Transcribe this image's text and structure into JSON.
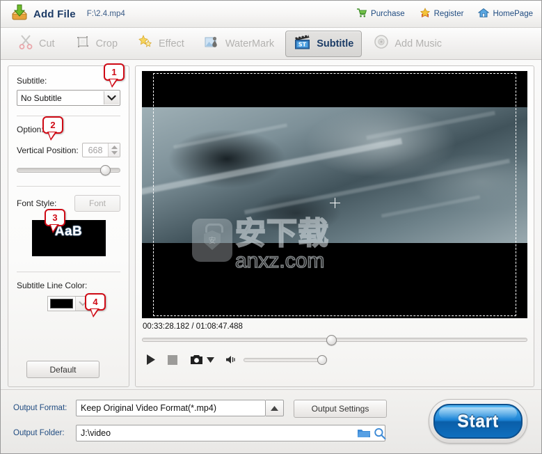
{
  "header": {
    "add_file_label": "Add File",
    "file_path": "F:\\2.4.mp4",
    "links": [
      {
        "label": "Purchase",
        "icon": "cart-icon"
      },
      {
        "label": "Register",
        "icon": "star-icon"
      },
      {
        "label": "HomePage",
        "icon": "home-icon"
      }
    ]
  },
  "tabs": [
    {
      "label": "Cut",
      "icon": "scissors-icon",
      "active": false
    },
    {
      "label": "Crop",
      "icon": "crop-icon",
      "active": false
    },
    {
      "label": "Effect",
      "icon": "sparkle-icon",
      "active": false
    },
    {
      "label": "WaterMark",
      "icon": "watermark-icon",
      "active": false
    },
    {
      "label": "Subtitle",
      "icon": "clapperboard-st-icon",
      "active": true
    },
    {
      "label": "Add Music",
      "icon": "disc-icon",
      "active": false
    }
  ],
  "sidebar": {
    "subtitle_label": "Subtitle:",
    "subtitle_value": "No Subtitle",
    "option_label": "Option:",
    "vertical_position_label": "Vertical Position:",
    "vertical_position_value": "668",
    "vertical_position_percent": 85,
    "font_style_label": "Font Style:",
    "font_button_label": "Font",
    "font_preview_text": "AaB",
    "subtitle_line_color_label": "Subtitle Line Color:",
    "subtitle_line_color_value": "#000000",
    "default_button_label": "Default"
  },
  "callouts": [
    {
      "number": "1"
    },
    {
      "number": "2"
    },
    {
      "number": "3"
    },
    {
      "number": "4"
    }
  ],
  "player": {
    "current_time": "00:33:28.182",
    "total_time": "01:08:47.488",
    "timecode": "00:33:28.182 / 01:08:47.488",
    "seek_percent": 49,
    "volume_percent": 100,
    "watermark_cn": "安下载",
    "watermark_en": "anxz.com",
    "watermark_shield_char": "安",
    "controls": [
      {
        "name": "play-button",
        "icon": "play-icon"
      },
      {
        "name": "stop-button",
        "icon": "stop-icon"
      },
      {
        "name": "snapshot-button",
        "icon": "camera-icon"
      },
      {
        "name": "snapshot-dropdown",
        "icon": "caret-down-icon"
      },
      {
        "name": "volume-icon",
        "icon": "speaker-icon"
      }
    ]
  },
  "footer": {
    "output_format_label": "Output Format:",
    "output_format_value": "Keep Original Video Format(*.mp4)",
    "output_settings_label": "Output Settings",
    "output_folder_label": "Output Folder:",
    "output_folder_value": "J:\\video",
    "start_label": "Start"
  },
  "colors": {
    "accent": "#1f4b80",
    "callout": "#cf0a15",
    "start_blue": "#1d84d6",
    "folder_blue": "#3c8ad6"
  }
}
